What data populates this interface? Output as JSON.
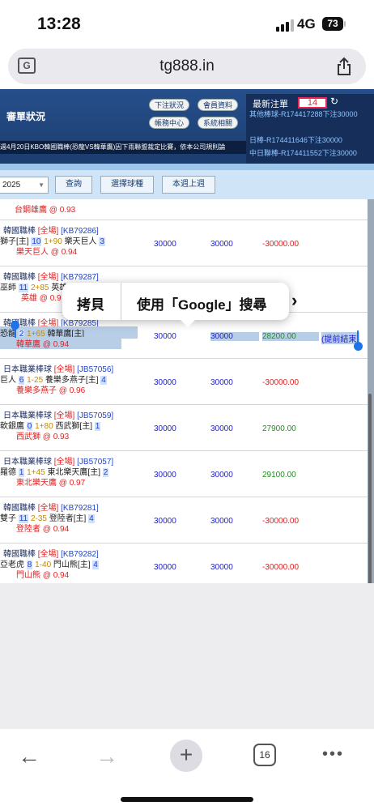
{
  "status": {
    "time": "13:28",
    "network": "4G",
    "battery": "73"
  },
  "browser": {
    "url": "tg888.in"
  },
  "header": {
    "title": "審單狀況",
    "buttons": [
      "下注狀況",
      "會員資料",
      "帳務中心",
      "系統相關"
    ],
    "latest_title": "最新注單",
    "latest_count": "14",
    "latest_lines": [
      "其他棒球-R174417288下注30000",
      "日棒-R174411646下注30000",
      "中日聯棒-R174411552下注30000"
    ],
    "notice": "週4月20日KBO韓國職棒(恐龍VS韓華鷹)因下雨聯盟裁定比賽，依本公司規則論"
  },
  "toolbar": {
    "date": "2025",
    "query": "查詢",
    "choose": "選擇球種",
    "week": "本週上週"
  },
  "top_row": {
    "team": "台鋼雄鷹",
    "odds": "@ 0.93"
  },
  "rows": [
    {
      "league": "韓國職棒",
      "tag": "[全場]",
      "code": "[KB79286]",
      "left": "獅子[主]",
      "n1": "10",
      "line": "1+90",
      "right": "樂天巨人",
      "n2": "3",
      "pick": "樂天巨人",
      "odds": "@ 0.94",
      "bet": "30000",
      "valid": "30000",
      "result": "-30000.00",
      "note": ""
    },
    {
      "league": "韓國職棒",
      "tag": "[全場]",
      "code": "[KB79287]",
      "left": "巫師",
      "n1": "11",
      "line": "2+85",
      "right": "英雄",
      "n2": "",
      "pick": "英雄",
      "odds": "@ 0.9",
      "bet": "",
      "valid": "",
      "result": "",
      "note": ""
    },
    {
      "league": "韓國職棒",
      "tag": "[全場]",
      "code": "[KB79285]",
      "left": "恐龍",
      "n1": "2",
      "line": "1+65",
      "right": "韓華鷹[主]",
      "n2": "",
      "pick": "韓華鷹",
      "odds": "@ 0.94",
      "bet": "30000",
      "valid": "30000",
      "result": "28200.00",
      "note": "(提前結束)"
    },
    {
      "league": "日本職業棒球",
      "tag": "[全場]",
      "code": "[JB57056]",
      "left": "巨人",
      "n1": "6",
      "line": "1-25",
      "right": "養樂多燕子[主]",
      "n2": "4",
      "pick": "養樂多燕子",
      "odds": "@ 0.96",
      "bet": "30000",
      "valid": "30000",
      "result": "-30000.00",
      "note": ""
    },
    {
      "league": "日本職業棒球",
      "tag": "[全場]",
      "code": "[JB57059]",
      "left": "軟銀鷹",
      "n1": "0",
      "line": "1+80",
      "right": "西武獅[主]",
      "n2": "1",
      "pick": "西武獅",
      "odds": "@ 0.93",
      "bet": "30000",
      "valid": "30000",
      "result": "27900.00",
      "note": ""
    },
    {
      "league": "日本職業棒球",
      "tag": "[全場]",
      "code": "[JB57057]",
      "left": "羅德",
      "n1": "1",
      "line": "1+45",
      "right": "東北樂天鷹[主]",
      "n2": "2",
      "pick": "東北樂天鷹",
      "odds": "@ 0.97",
      "bet": "30000",
      "valid": "30000",
      "result": "29100.00",
      "note": ""
    },
    {
      "league": "韓國職棒",
      "tag": "[全場]",
      "code": "[KB79281]",
      "left": "雙子",
      "n1": "11",
      "line": "2-35",
      "right": "登陸者[主]",
      "n2": "4",
      "pick": "登陸者",
      "odds": "@ 0.94",
      "bet": "30000",
      "valid": "30000",
      "result": "-30000.00",
      "note": ""
    },
    {
      "league": "韓國職棒",
      "tag": "[全場]",
      "code": "[KB79282]",
      "left": "亞老虎",
      "n1": "8",
      "line": "1-40",
      "right": "門山熊[主]",
      "n2": "4",
      "pick": "門山熊",
      "odds": "@ 0.94",
      "bet": "30000",
      "valid": "30000",
      "result": "-30000.00",
      "note": ""
    }
  ],
  "context_menu": {
    "copy": "拷貝",
    "search": "使用「Google」搜尋",
    "more": "›"
  },
  "bottom": {
    "back": "←",
    "forward": "→",
    "new_tab": "+",
    "tab_count": "16",
    "more": "•••"
  },
  "colors": {
    "header": "#264f8a",
    "toolbar": "#cfe4f7",
    "selection": "#1e73e8",
    "loss": "#d22222",
    "win": "#1d8f1d"
  }
}
